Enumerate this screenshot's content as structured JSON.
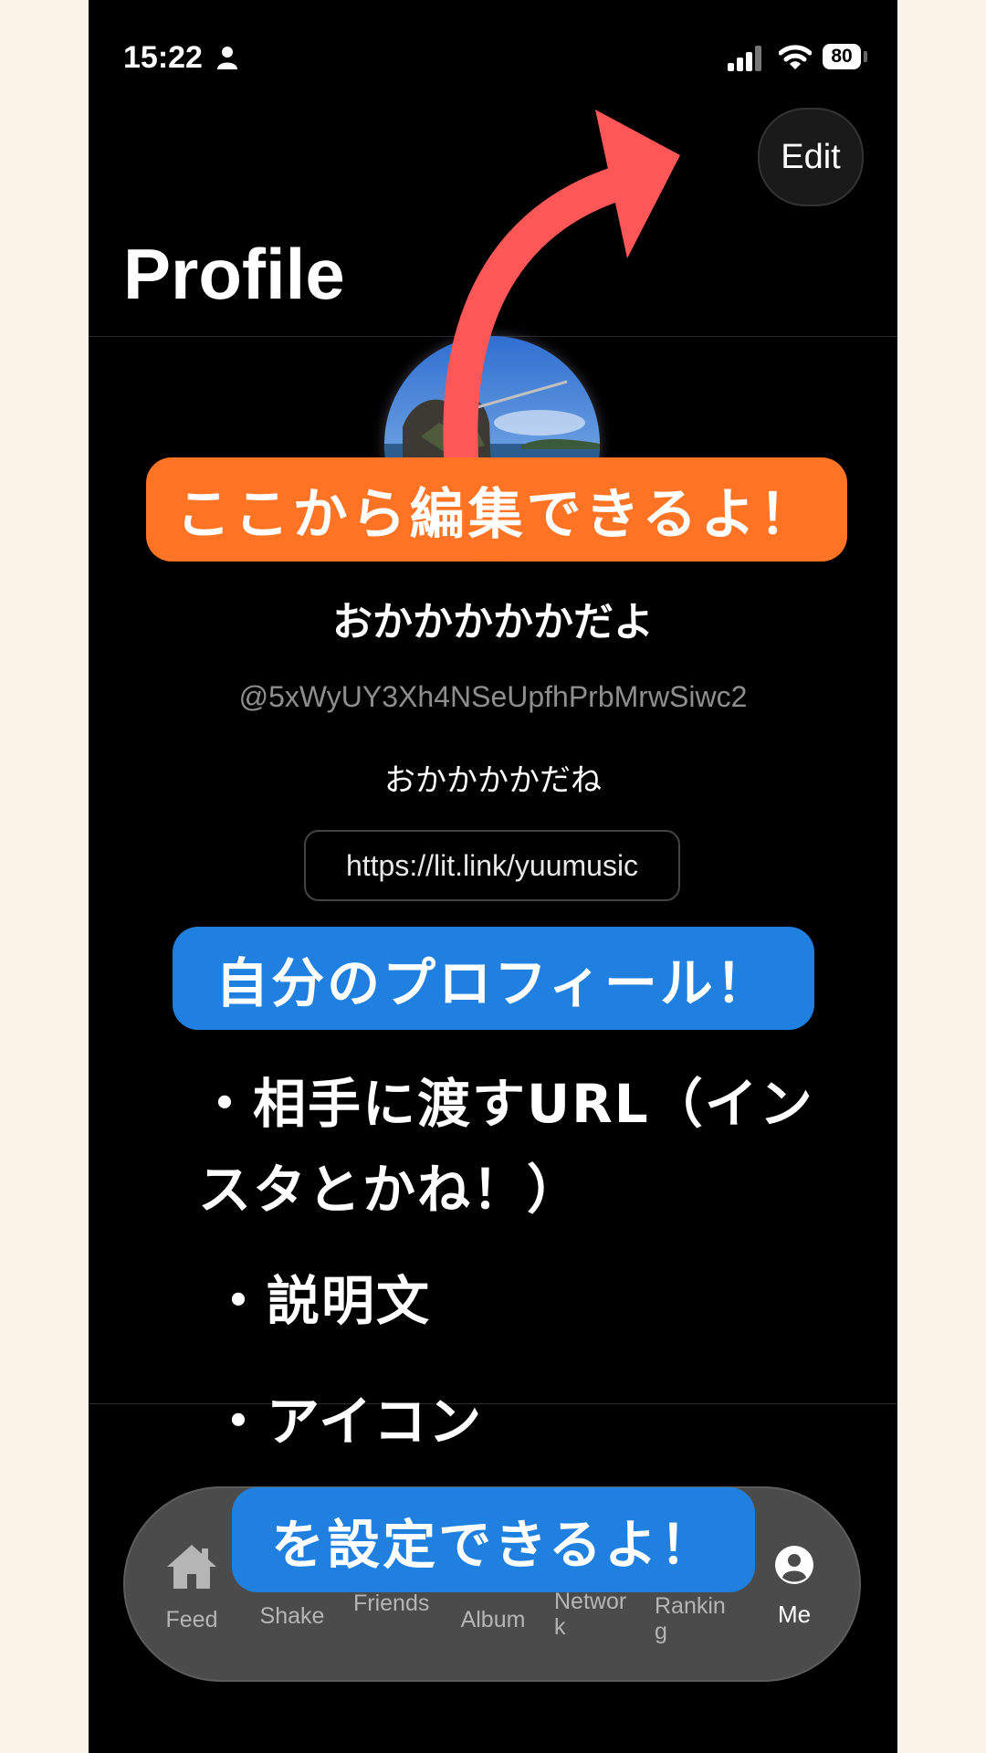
{
  "status_bar": {
    "time": "15:22",
    "battery": "80"
  },
  "header": {
    "edit_label": "Edit",
    "title": "Profile"
  },
  "profile": {
    "display_name": "おかかかかかだよ",
    "handle": "@5xWyUY3Xh4NSeUpfhPrbMrwSiwc2",
    "bio": "おかかかかだね",
    "link": "https://lit.link/yuumusic"
  },
  "tab_bar": {
    "items": [
      {
        "label": "Feed",
        "icon": "home-icon"
      },
      {
        "label": "Shake",
        "icon": "shake-icon"
      },
      {
        "label": "Friends",
        "icon": "friends-icon"
      },
      {
        "label": "Album",
        "icon": "album-icon"
      },
      {
        "label": "Network",
        "icon": "network-icon"
      },
      {
        "label": "Ranking",
        "icon": "ranking-icon"
      },
      {
        "label": "Me",
        "icon": "person-icon"
      }
    ],
    "active_index": 6
  },
  "annotations": {
    "edit_banner": "ここから編集できるよ！",
    "profile_banner": "自分のプロフィール！",
    "bullets": [
      "・相手に渡すURL（インスタとかね！）",
      "・説明文",
      "・アイコン"
    ],
    "set_banner": "を設定できるよ！"
  },
  "colors": {
    "page_background": "#FBF3E8",
    "screen_background": "#000000",
    "edit_banner": "#FF7324",
    "blue_banner": "#1F80E0",
    "arrow": "#FF5757",
    "tab_bar": "#4B4B4B"
  }
}
